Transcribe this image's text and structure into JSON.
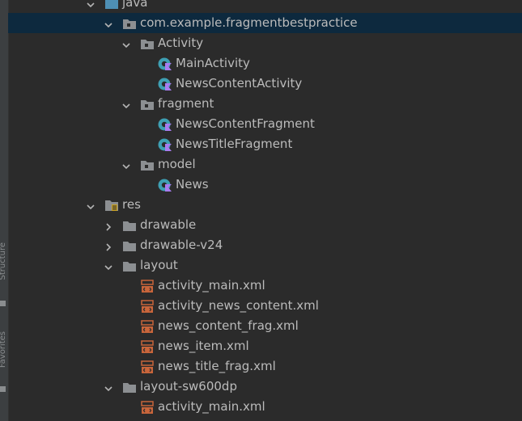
{
  "sidebar": {
    "structure_label": "Structure",
    "favorites_label": "Favorites"
  },
  "tree": {
    "items": [
      {
        "label": "java",
        "type": "folder-blue",
        "expanded": true
      },
      {
        "label": "com.example.fragmentbestpractice",
        "type": "package",
        "expanded": true,
        "selected": true
      },
      {
        "label": "Activity",
        "type": "package",
        "expanded": true
      },
      {
        "label": "MainActivity",
        "type": "kotlin-class"
      },
      {
        "label": "NewsContentActivity",
        "type": "kotlin-class"
      },
      {
        "label": "fragment",
        "type": "package",
        "expanded": true
      },
      {
        "label": "NewsContentFragment",
        "type": "kotlin-class"
      },
      {
        "label": "NewsTitleFragment",
        "type": "kotlin-class"
      },
      {
        "label": "model",
        "type": "package",
        "expanded": true
      },
      {
        "label": "News",
        "type": "kotlin-class"
      },
      {
        "label": "res",
        "type": "res-folder",
        "expanded": true
      },
      {
        "label": "drawable",
        "type": "folder",
        "expanded": false
      },
      {
        "label": "drawable-v24",
        "type": "folder",
        "expanded": false
      },
      {
        "label": "layout",
        "type": "folder",
        "expanded": true
      },
      {
        "label": "activity_main.xml",
        "type": "xml-layout"
      },
      {
        "label": "activity_news_content.xml",
        "type": "xml-layout"
      },
      {
        "label": "news_content_frag.xml",
        "type": "xml-layout"
      },
      {
        "label": "news_item.xml",
        "type": "xml-layout"
      },
      {
        "label": "news_title_frag.xml",
        "type": "xml-layout"
      },
      {
        "label": "layout-sw600dp",
        "type": "folder",
        "expanded": true
      },
      {
        "label": "activity_main.xml",
        "type": "xml-layout"
      }
    ]
  },
  "colors": {
    "background": "#2b2b2b",
    "selection": "#0d293e",
    "text": "#bbbbbb",
    "folder": "#8c8f92",
    "java_folder": "#4e8fb4",
    "kotlin_circle": "#3e9fb3",
    "kotlin_k": "#a87cf0",
    "xml_icon": "#c8653b"
  }
}
